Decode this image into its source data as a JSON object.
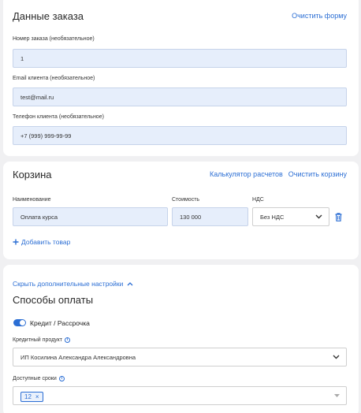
{
  "order": {
    "title": "Данные заказа",
    "clear_form": "Очистить форму",
    "order_number_label": "Номер заказа (необязательное)",
    "order_number_value": "1",
    "email_label": "Email клиента (необязательное)",
    "email_value": "test@mail.ru",
    "phone_label": "Телефон клиента (необязательное)",
    "phone_value": "+7 (999) 999-99-99"
  },
  "cart": {
    "title": "Корзина",
    "calculator_link": "Калькулятор расчетов",
    "clear_cart": "Очистить корзину",
    "col_name": "Наименование",
    "col_price": "Стоимость",
    "col_vat": "НДС",
    "item_name": "Оплата курса",
    "item_price": "130 000",
    "item_vat": "Без НДС",
    "add_item": "Добавить товар"
  },
  "extra": {
    "hide_settings": "Скрыть дополнительные настройки",
    "payment_methods_title": "Способы оплаты",
    "credit_toggle_label": "Кредит / Рассрочка",
    "credit_toggle_on": true,
    "credit_product_label": "Кредитный продукт",
    "credit_product_value": "ИП Косилина Александра Александровна",
    "terms_label": "Доступные сроки",
    "terms_chip": "12"
  },
  "colors": {
    "accent": "#2b6ed4",
    "field_bg": "#e6eefb",
    "danger_icon": "#2b6ed4"
  },
  "icons": [
    "chevron-down-icon",
    "trash-icon",
    "plus-icon",
    "chevron-up-icon",
    "info-icon",
    "close-icon"
  ]
}
